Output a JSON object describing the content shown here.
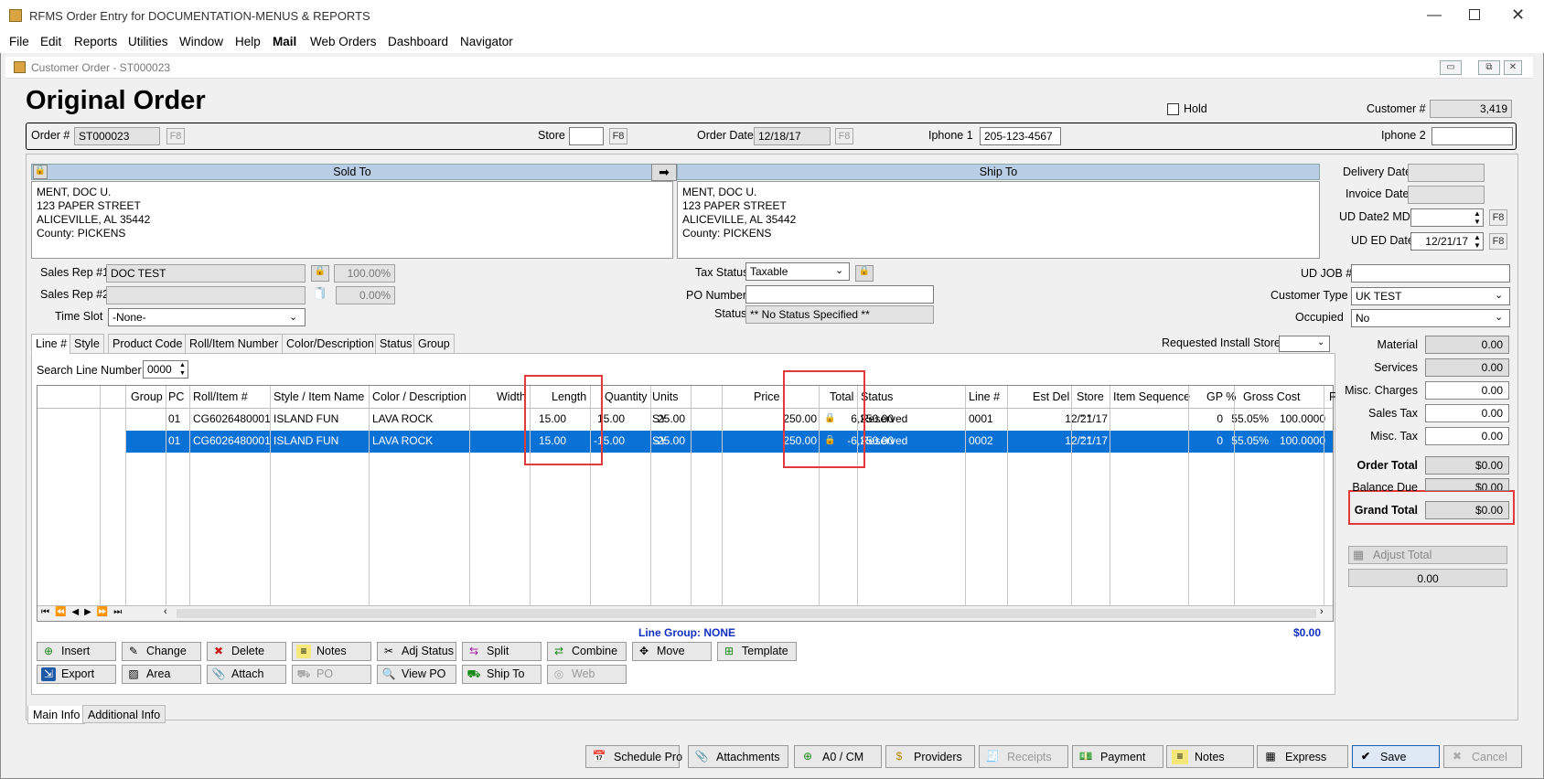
{
  "app": {
    "title": "RFMS Order Entry for DOCUMENTATION-MENUS & REPORTS",
    "menu": [
      "File",
      "Edit",
      "Reports",
      "Utilities",
      "Window",
      "Help",
      "Mail",
      "Web Orders",
      "Dashboard",
      "Navigator"
    ]
  },
  "child": {
    "title": "Customer Order - ST000023"
  },
  "heading": "Original Order",
  "hold": {
    "label": "Hold",
    "checked": false
  },
  "customer": {
    "label": "Customer #",
    "value": "3,419"
  },
  "order_row": {
    "order_label": "Order #",
    "order_value": "ST000023",
    "f8": "F8",
    "store_label": "Store",
    "store_value": "",
    "date_label": "Order Date",
    "date_value": "12/18/17",
    "iphone1_label": "Iphone 1",
    "iphone1_value": "205-123-4567",
    "iphone2_label": "Iphone 2",
    "iphone2_value": ""
  },
  "sold_to": {
    "header": "Sold To",
    "lines": [
      "MENT, DOC U.",
      "123 PAPER STREET",
      "ALICEVILLE, AL  35442",
      "County: PICKENS"
    ]
  },
  "ship_to": {
    "header": "Ship To",
    "lines": [
      "MENT, DOC U.",
      "123 PAPER STREET",
      "ALICEVILLE, AL  35442",
      "County: PICKENS"
    ]
  },
  "dates": {
    "delivery_label": "Delivery Date",
    "delivery_value": "",
    "invoice_label": "Invoice Date",
    "invoice_value": "",
    "ud2_label": "UD Date2 MD",
    "ud2_value": "",
    "uded_label": "UD ED Date",
    "uded_value": "12/21/17"
  },
  "sales": {
    "rep1_label": "Sales Rep #1",
    "rep1_value": "DOC TEST",
    "rep1_pct": "100.00%",
    "rep2_label": "Sales Rep #2",
    "rep2_value": "",
    "rep2_pct": "0.00%",
    "timeslot_label": "Time Slot",
    "timeslot_value": "-None-"
  },
  "tax": {
    "status_label": "Tax Status",
    "status_value": "Taxable",
    "po_label": "PO Number",
    "po_value": "",
    "st_label": "Status",
    "st_value": "** No Status Specified **"
  },
  "right_fields": {
    "udjob_label": "UD JOB #",
    "udjob_value": "",
    "custtype_label": "Customer Type",
    "custtype_value": "UK TEST",
    "occupied_label": "Occupied",
    "occupied_value": "No"
  },
  "tabs": [
    "Line #",
    "Style",
    "Product Code",
    "Roll/Item Number",
    "Color/Description",
    "Status",
    "Group"
  ],
  "req_install_label": "Requested Install Store",
  "search": {
    "label": "Search Line Number",
    "value": "0000"
  },
  "grid": {
    "columns": [
      "Group",
      "PC",
      "Roll/Item #",
      "Style / Item Name",
      "Color / Description",
      "Width",
      "Length",
      "Quantity",
      "Units",
      "Price",
      "Total",
      "Status",
      "Line #",
      "Est Del",
      "Store",
      "Item Sequence",
      "GP %",
      "Gross Cost",
      "F"
    ],
    "rows": [
      {
        "pc": "01",
        "roll": "CG6026480001",
        "style": "ISLAND FUN",
        "color": "LAVA ROCK",
        "width": "15.00",
        "length": "15.00",
        "qty": "25.00",
        "units": "SY",
        "price": "250.00",
        "total": "6,250.00",
        "status": "Reserved",
        "line": "0001",
        "estdel": "12/21/17",
        "store": "\" \"",
        "seq": "0",
        "gp": "55.05%",
        "cost": "100.0000"
      },
      {
        "pc": "01",
        "roll": "CG6026480001",
        "style": "ISLAND FUN",
        "color": "LAVA ROCK",
        "width": "15.00",
        "length": "-15.00",
        "qty": "-25.00",
        "units": "SY",
        "price": "250.00",
        "total": "-6,250.00",
        "status": "Reserved",
        "line": "0002",
        "estdel": "12/21/17",
        "store": "\" \"",
        "seq": "0",
        "gp": "55.05%",
        "cost": "100.0000"
      }
    ]
  },
  "line_group": "Line Group: NONE",
  "line_total": "$0.00",
  "buttons_row1": [
    "Insert",
    "Change",
    "Delete",
    "Notes",
    "Adj Status",
    "Split",
    "Combine",
    "Move",
    "Template"
  ],
  "buttons_row2": [
    "Export",
    "Area",
    "Attach",
    "PO",
    "View PO",
    "Ship To",
    "Web"
  ],
  "totals": {
    "material_label": "Material",
    "material": "0.00",
    "services_label": "Services",
    "services": "0.00",
    "misc_label": "Misc. Charges",
    "misc": "0.00",
    "salestax_label": "Sales Tax",
    "salestax": "0.00",
    "misctax_label": "Misc. Tax",
    "misctax": "0.00",
    "order_label": "Order Total",
    "order": "$0.00",
    "balance_label": "Balance Due",
    "balance": "$0.00",
    "grand_label": "Grand Total",
    "grand": "$0.00",
    "adjust_label": "Adjust Total",
    "adjust_value": "0.00"
  },
  "bottom_tabs": [
    "Main Info",
    "Additional Info"
  ],
  "footer_buttons": [
    "Schedule Pro",
    "Attachments",
    "A0 / CM",
    "Providers",
    "Receipts",
    "Payment",
    "Notes",
    "Express",
    "Save",
    "Cancel"
  ]
}
